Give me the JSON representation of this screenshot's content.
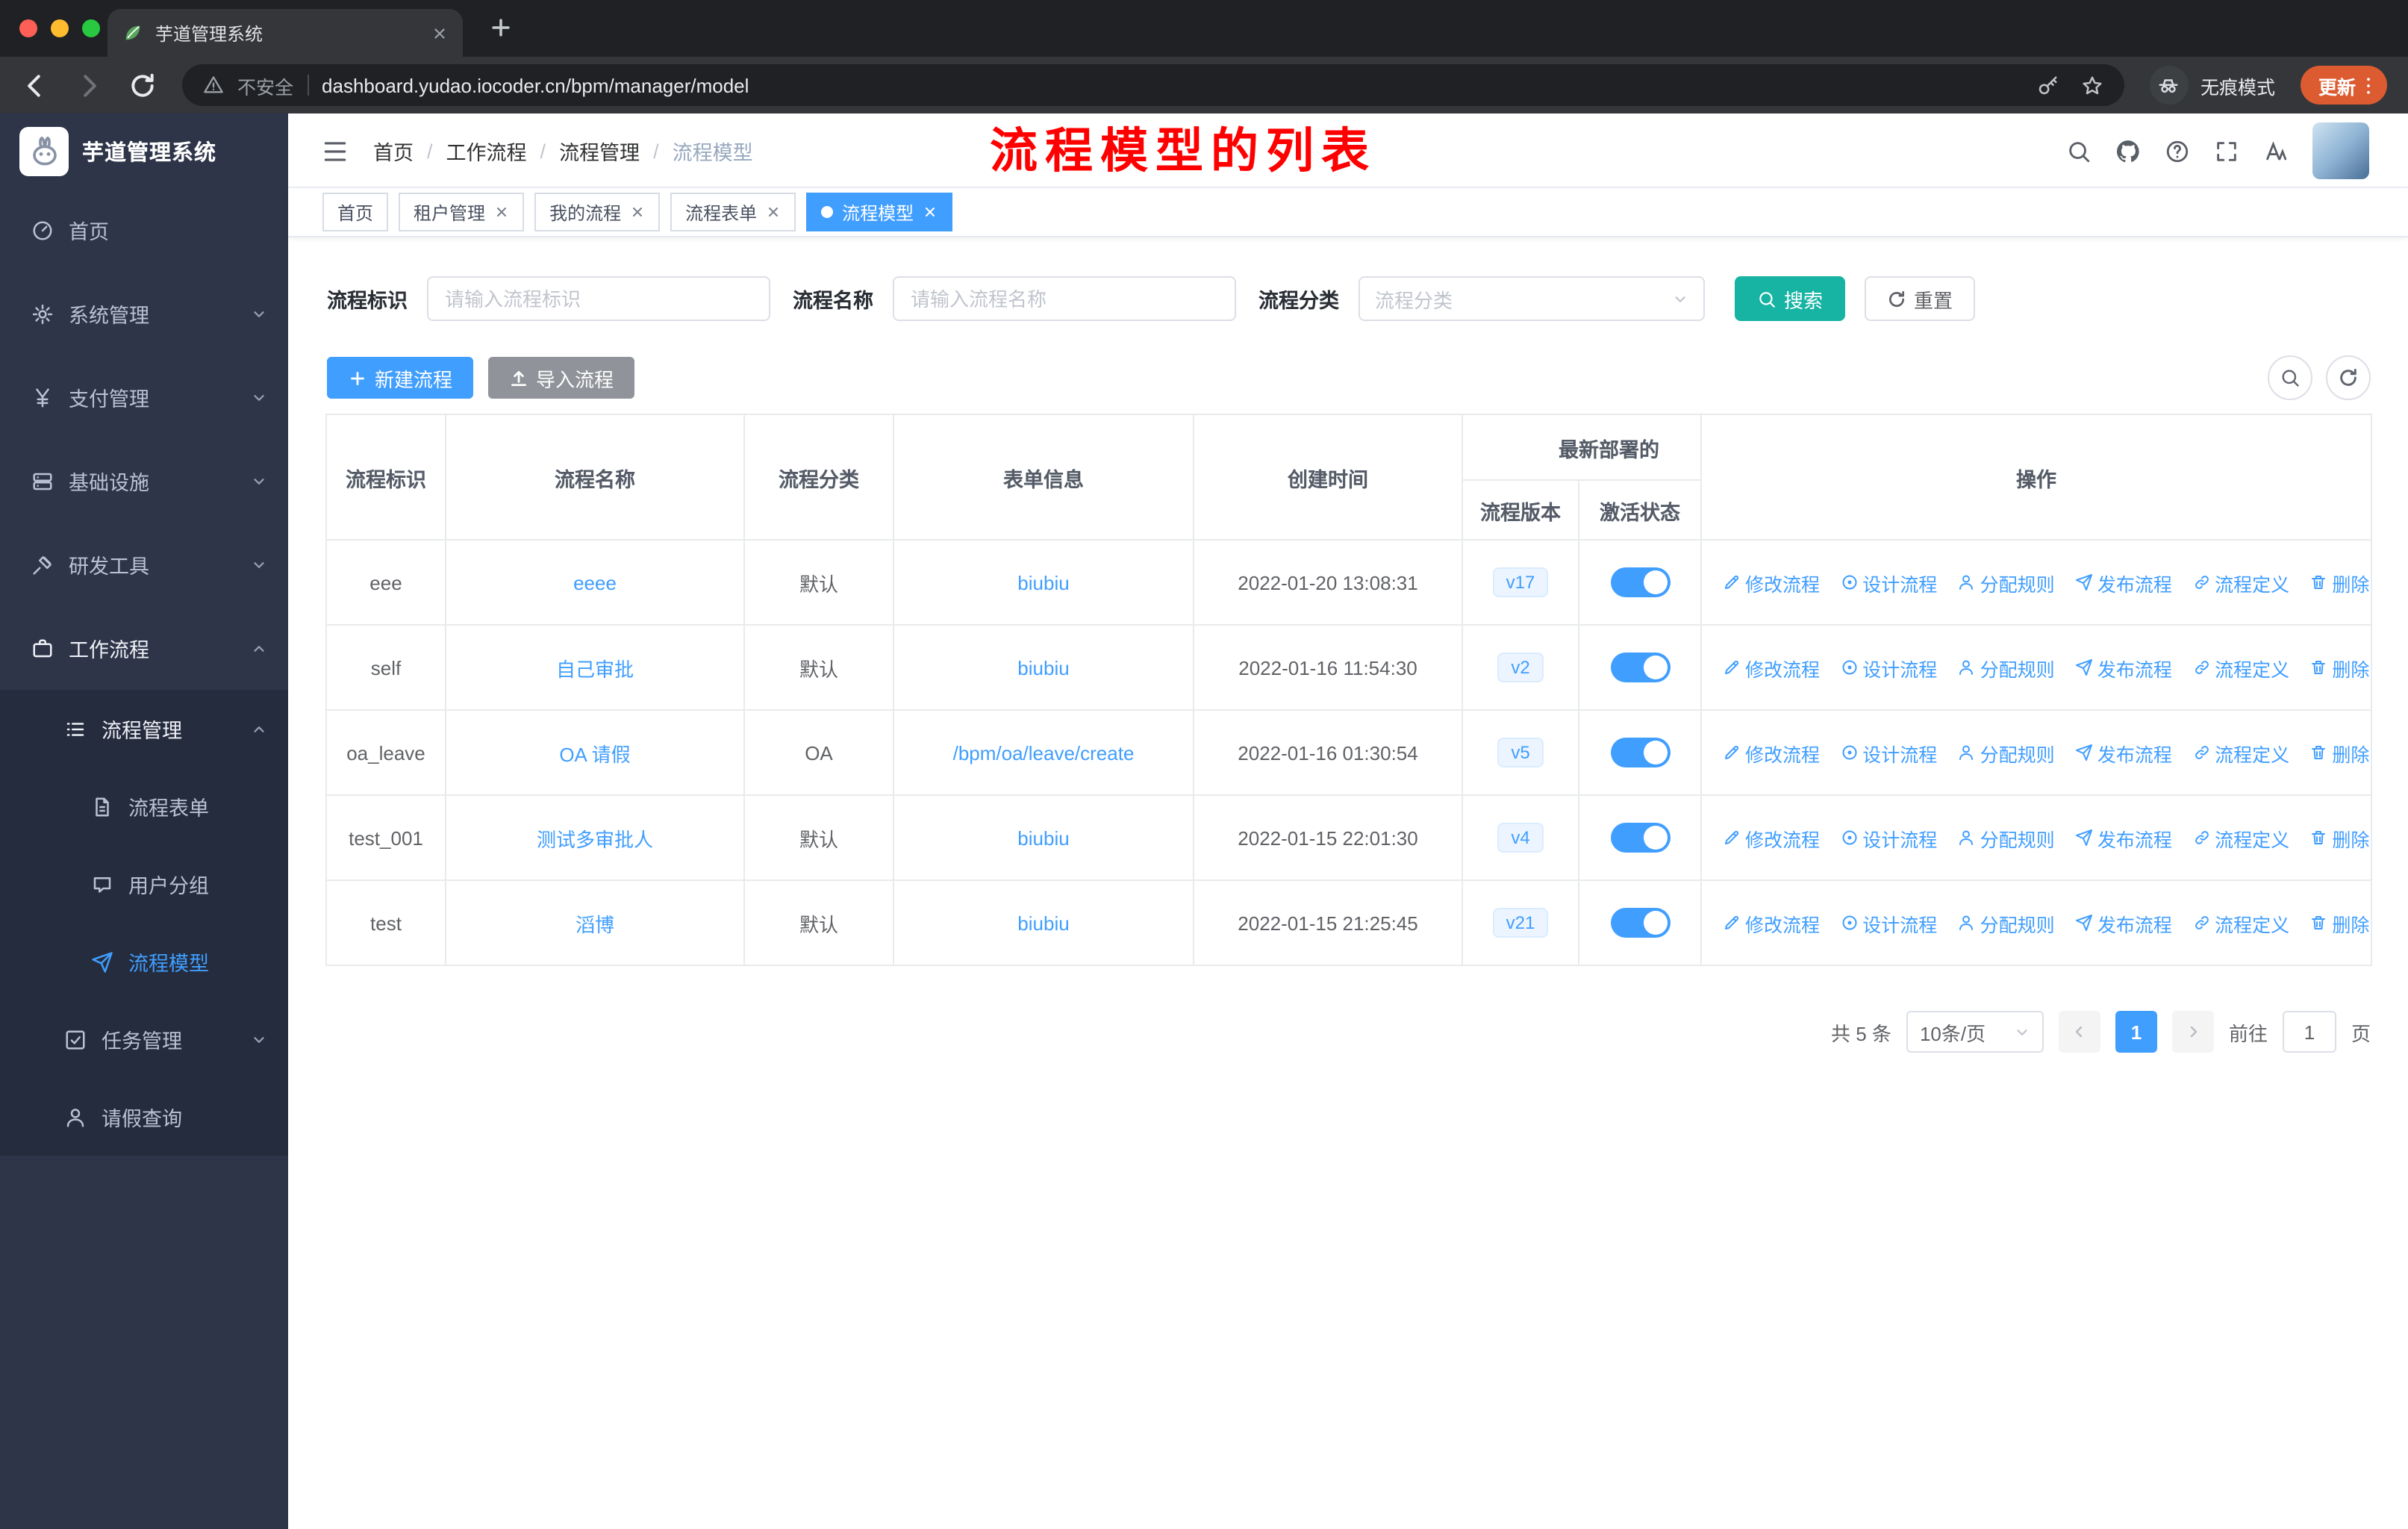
{
  "colors": {
    "accent_blue": "#409eff",
    "search_button_teal": "#17b3a3",
    "import_button_gray": "#909399",
    "annotation_red": "#ff0000",
    "sidebar_bg": "#2e3549",
    "submenu_bg": "#252c3e",
    "version_badge_bg": "#ecf5ff",
    "update_pill_orange": "#dd5b30"
  },
  "browser": {
    "tab_title": "芋道管理系统",
    "security_label": "不安全",
    "url": "dashboard.yudao.iocoder.cn/bpm/manager/model",
    "incognito_label": "无痕模式",
    "update_label": "更新"
  },
  "sidebar": {
    "title": "芋道管理系统",
    "items": [
      "首页",
      "系统管理",
      "支付管理",
      "基础设施",
      "研发工具",
      "工作流程",
      "流程管理",
      "流程表单",
      "用户分组",
      "流程模型",
      "任务管理",
      "请假查询"
    ]
  },
  "header": {
    "breadcrumb": [
      "首页",
      "工作流程",
      "流程管理",
      "流程模型"
    ],
    "separator": "/",
    "annotation": "流程模型的列表"
  },
  "tags": [
    "首页",
    "租户管理",
    "我的流程",
    "流程表单",
    "流程模型"
  ],
  "filters": {
    "id_label": "流程标识",
    "id_placeholder": "请输入流程标识",
    "name_label": "流程名称",
    "name_placeholder": "请输入流程名称",
    "category_label": "流程分类",
    "category_placeholder": "流程分类",
    "search_label": "搜索",
    "reset_label": "重置"
  },
  "toolbar": {
    "create_label": "新建流程",
    "import_label": "导入流程"
  },
  "table": {
    "headers": {
      "id": "流程标识",
      "name": "流程名称",
      "category": "流程分类",
      "form": "表单信息",
      "created": "创建时间",
      "deploy_group": "最新部署的",
      "version": "流程版本",
      "status": "激活状态",
      "actions": "操作"
    },
    "actions": [
      "修改流程",
      "设计流程",
      "分配规则",
      "发布流程",
      "流程定义",
      "删除"
    ],
    "rows": [
      {
        "id": "eee",
        "name": "eeee",
        "category": "默认",
        "form": "biubiu",
        "created": "2022-01-20 13:08:31",
        "version": "v17"
      },
      {
        "id": "self",
        "name": "自己审批",
        "category": "默认",
        "form": "biubiu",
        "created": "2022-01-16 11:54:30",
        "version": "v2"
      },
      {
        "id": "oa_leave",
        "name": "OA 请假",
        "category": "OA",
        "form": "/bpm/oa/leave/create",
        "created": "2022-01-16 01:30:54",
        "version": "v5"
      },
      {
        "id": "test_001",
        "name": "测试多审批人",
        "category": "默认",
        "form": "biubiu",
        "created": "2022-01-15 22:01:30",
        "version": "v4"
      },
      {
        "id": "test",
        "name": "滔博",
        "category": "默认",
        "form": "biubiu",
        "created": "2022-01-15 21:25:45",
        "version": "v21"
      }
    ]
  },
  "pagination": {
    "total": "共 5 条",
    "page_size": "10条/页",
    "page": "1",
    "goto_label": "前往",
    "goto_value": "1",
    "unit_label": "页"
  }
}
